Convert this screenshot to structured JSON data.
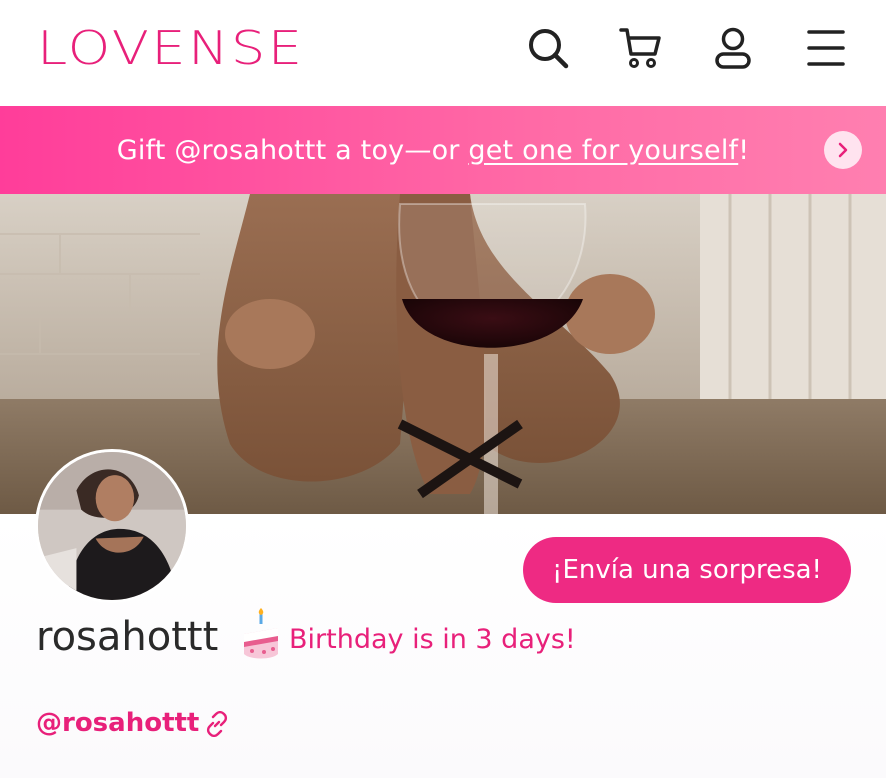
{
  "header": {
    "logo_text": "LOVENSE",
    "icons": [
      "search-icon",
      "cart-icon",
      "account-icon",
      "menu-icon"
    ]
  },
  "promo": {
    "text_prefix": "Gift @rosahottt a toy—or ",
    "link_text": "get one for yourself",
    "text_suffix": "!"
  },
  "profile": {
    "username": "rosahottt",
    "birthday_text": "Birthday is in 3 days!",
    "handle": "@rosahottt",
    "surprise_button_label": "¡Envía una sorpresa!"
  },
  "colors": {
    "brand_pink": "#e8207a",
    "button_pink": "#ee2a83",
    "banner_start": "#ff3d9a",
    "banner_end": "#ff7fb0"
  }
}
